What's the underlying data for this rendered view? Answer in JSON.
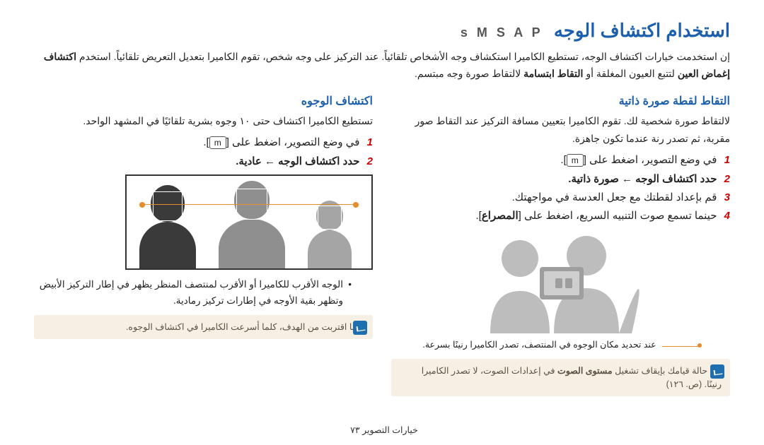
{
  "title": "استخدام اكتشاف الوجه",
  "modes": "s M S A P",
  "intro_html": "إن استخدمت خيارات اكتشاف الوجه، تستطيع الكاميرا استكشاف وجه الأشخاص تلقائياً. عند التركيز على وجه شخص، تقوم الكاميرا بتعديل التعريض تلقائياً. استخدم <b>اكتشاف إغماض العين</b> لتتبع العيون المغلقة أو <b>التقاط ابتسامة</b> لالتقاط صورة وجه مبتسم.",
  "right": {
    "heading": "اكتشاف الوجوه",
    "p1": "تستطيع الكاميرا اكتشاف حتى ١٠ وجوه بشرية تلقائيًا في المشهد الواحد.",
    "step1_pre": "في وضع التصوير، اضغط على [",
    "step1_key": "m",
    "step1_post": "].",
    "step2_html": "حدد <b>اكتشاف الوجه</b> ← <b>عادية</b>.",
    "bul1": "الوجه الأقرب للكاميرا أو الأقرب لمنتصف المنظر يظهر في إطار التركيز الأبيض وتظهر بقية الأوجه في إطارات تركيز رمادية.",
    "note": "كلما اقتربت من الهدف، كلما أسرعت الكاميرا في اكتشاف الوجوه."
  },
  "left": {
    "heading": "التقاط لقطة صورة ذاتية",
    "p1": "لالتقاط صورة شخصية لك. تقوم الكاميرا بتعيين مسافة التركيز عند التقاط صور مقربة، ثم تصدر رنة عندما تكون جاهزة.",
    "step1_pre": "في وضع التصوير، اضغط على [",
    "step1_key": "m",
    "step1_post": "].",
    "step2_html": "حدد <b>اكتشاف الوجه</b> ← <b>صورة ذاتية</b>.",
    "step3": "قم بإعداد لقطتك مع جعل العدسة في مواجهتك.",
    "step4_html": "حينما تسمع صوت التنبيه السريع، اضغط على [<b>المصراع</b>].",
    "caption": "عند تحديد مكان الوجوه في المنتصف، تصدر الكاميرا رنينًا بسرعة.",
    "note_html": "في حالة قيامك بإيقاف تشغيل <b>مستوى الصوت</b> في إعدادات الصوت، لا تصدر الكاميرا رنينًا. (ص. ١٢٦)"
  },
  "footer": {
    "section": "خيارات التصوير",
    "page": "٧٣"
  }
}
